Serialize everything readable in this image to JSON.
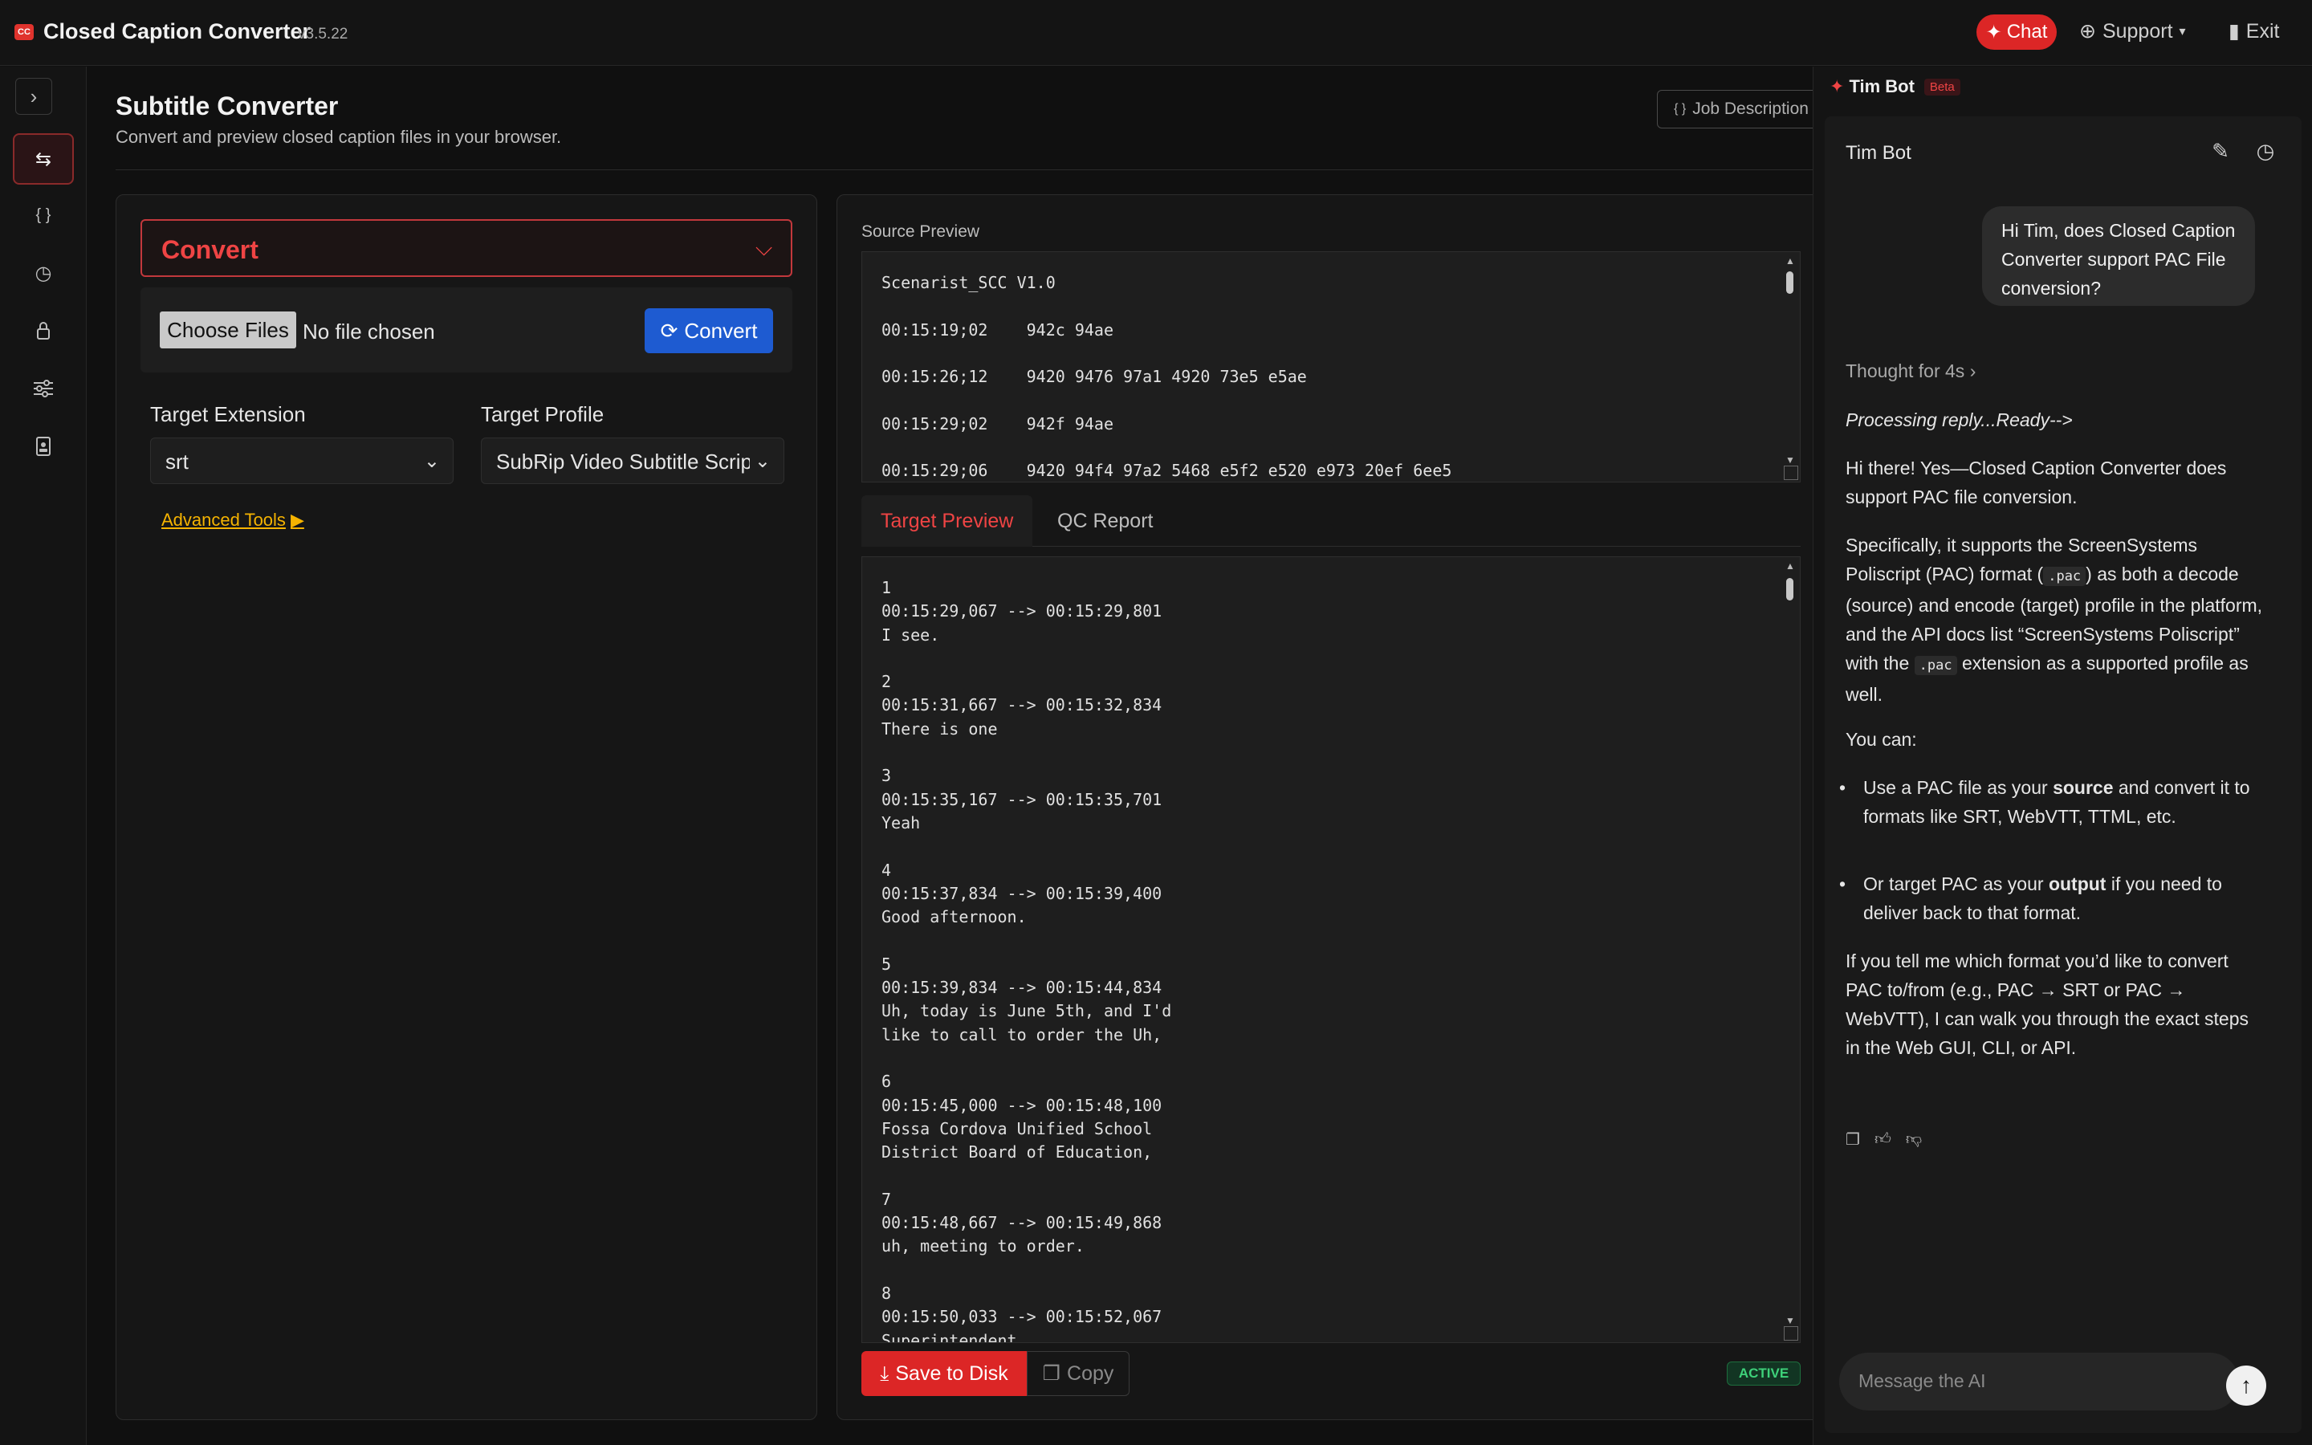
{
  "app": {
    "title": "Closed Caption Converter",
    "version": "v3.5.22",
    "logo_text": "CC"
  },
  "topbar": {
    "chat_label": "Chat",
    "support_label": "Support",
    "exit_label": "Exit"
  },
  "sidebar": {
    "items": [
      "convert-arrows-icon",
      "braces-icon",
      "history-icon",
      "lock-icon",
      "sliders-icon",
      "badge-icon"
    ]
  },
  "page": {
    "title": "Subtitle Converter",
    "subtitle": "Convert and preview closed caption files in your browser.",
    "job_description_label": "Job Description"
  },
  "convert_panel": {
    "header": "Convert",
    "choose_files_label": "Choose Files",
    "no_file_text": "No file chosen",
    "convert_button": "Convert",
    "target_extension_label": "Target Extension",
    "target_extension_value": "srt",
    "target_profile_label": "Target Profile",
    "target_profile_value": "SubRip Video Subtitle Script",
    "advanced_tools_label": "Advanced Tools"
  },
  "preview": {
    "source_label": "Source Preview",
    "source_text": "Scenarist_SCC V1.0\n\n00:15:19;02\t942c 94ae\n\n00:15:26;12\t9420 9476 97a1 4920 73e5 e5ae\n\n00:15:29;02\t942f 94ae\n\n00:15:29;06\t9420 94f4 97a2 5468 e5f2 e520 e973 20ef 6ee5",
    "tabs": [
      "Target Preview",
      "QC Report"
    ],
    "target_text": "1\n00:15:29,067 --> 00:15:29,801\nI see.\n\n2\n00:15:31,667 --> 00:15:32,834\nThere is one\n\n3\n00:15:35,167 --> 00:15:35,701\nYeah\n\n4\n00:15:37,834 --> 00:15:39,400\nGood afternoon.\n\n5\n00:15:39,834 --> 00:15:44,834\nUh, today is June 5th, and I'd\nlike to call to order the Uh,\n\n6\n00:15:45,000 --> 00:15:48,100\nFossa Cordova Unified School\nDistrict Board of Education,\n\n7\n00:15:48,667 --> 00:15:49,868\nuh, meeting to order.\n\n8\n00:15:50,033 --> 00:15:52,067\nSuperintendent",
    "save_label": "Save to Disk",
    "copy_label": "Copy",
    "status_badge": "ACTIVE"
  },
  "bot": {
    "panel_title": "Tim Bot",
    "beta_label": "Beta",
    "name": "Tim Bot",
    "user_message": "Hi Tim, does Closed Caption Converter support PAC File conversion?",
    "thought_label": "Thought for 4s",
    "processing": "Processing reply...Ready-->",
    "p1": "Hi there! Yes—Closed Caption Converter does support PAC file conversion.",
    "p2_a": "Specifically, it supports the ScreenSystems Poliscript (PAC) format (",
    "p2_code": ".pac",
    "p2_b": ") as both a decode (source) and encode (target) profile in the platform, and the API docs list “ScreenSystems Poliscript” with the ",
    "p2_code2": ".pac",
    "p2_c": " extension as a supported profile as well.",
    "you_can": "You can:",
    "bullet1_a": "Use a PAC file as your ",
    "bullet1_b": "source",
    "bullet1_c": " and convert it to formats like SRT, WebVTT, TTML, etc.",
    "bullet2_a": "Or target PAC as your ",
    "bullet2_b": "output",
    "bullet2_c": " if you need to deliver back to that format.",
    "p3": "If you tell me which format you’d like to convert PAC to/from (e.g., PAC → SRT or PAC → WebVTT), I can walk you through the exact steps in the Web GUI, CLI, or API.",
    "input_placeholder": "Message the AI"
  },
  "colors": {
    "accent_red": "#dc2626",
    "convert_blue": "#1e5bd1",
    "link_amber": "#f5b301",
    "active_green": "#3ed17a"
  }
}
